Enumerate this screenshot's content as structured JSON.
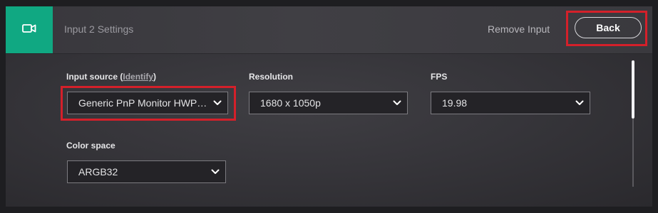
{
  "header": {
    "icon": "video-camera-icon",
    "title": "Input 2 Settings",
    "remove_label": "Remove Input",
    "back_label": "Back"
  },
  "fields": {
    "input_source": {
      "label": "Input source",
      "identify_label": "Identify",
      "value": "Generic PnP Monitor HWP2..."
    },
    "resolution": {
      "label": "Resolution",
      "value": "1680 x 1050p"
    },
    "fps": {
      "label": "FPS",
      "value": "19.98"
    },
    "color_space": {
      "label": "Color space",
      "value": "ARGB32"
    }
  },
  "colors": {
    "accent": "#10a882",
    "highlight": "#d4202a"
  }
}
